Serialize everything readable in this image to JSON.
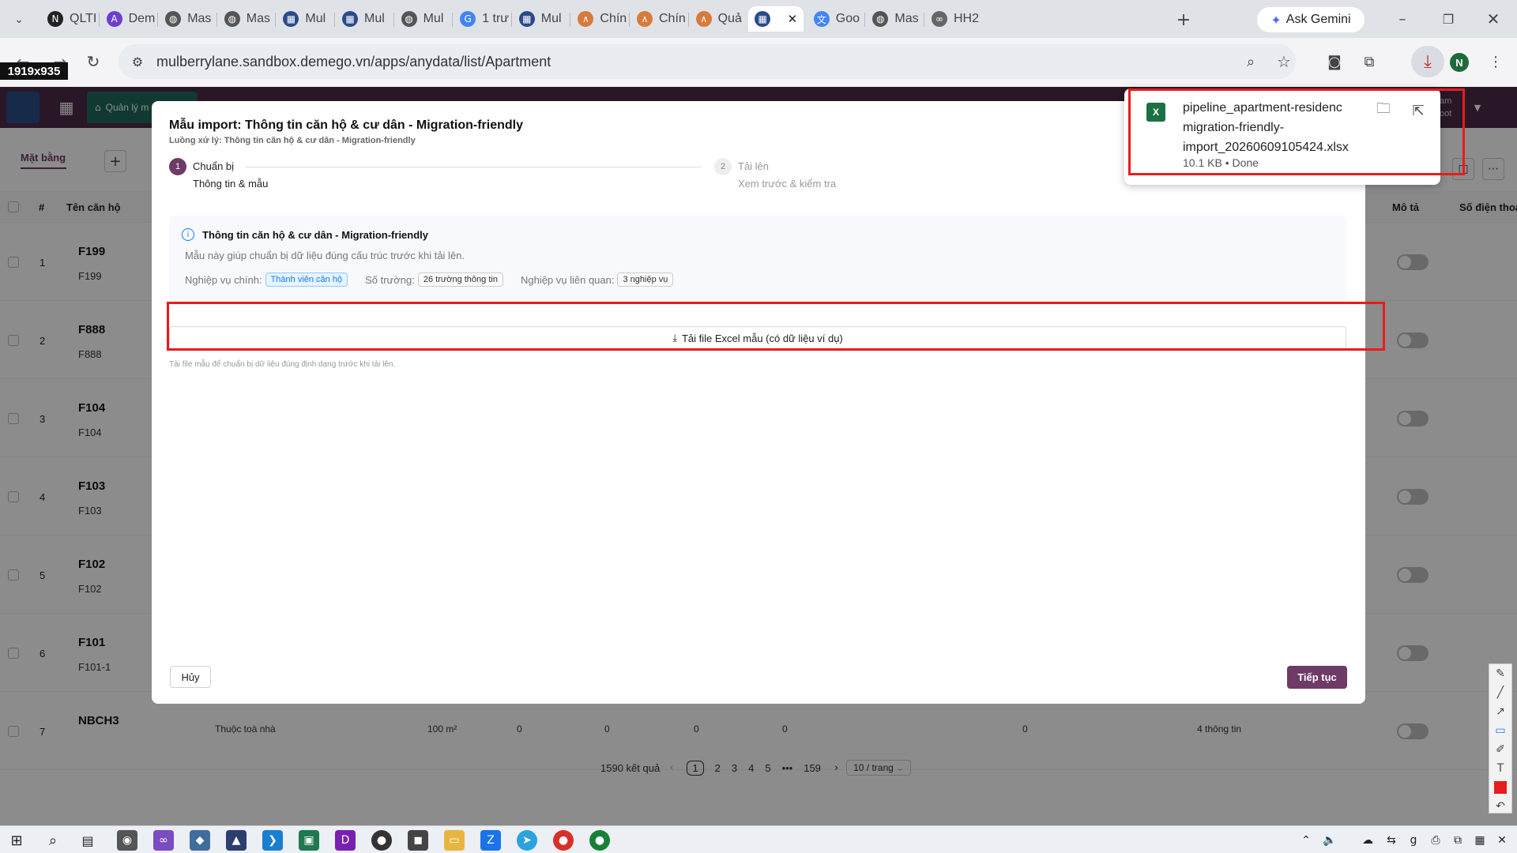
{
  "browser": {
    "tabs": [
      {
        "label": "QLTI",
        "icon": "notion-icon",
        "color": "#222"
      },
      {
        "label": "Dem",
        "icon": "app-icon",
        "color": "#6b3fd0"
      },
      {
        "label": "Mas",
        "icon": "globe-icon",
        "color": "#555"
      },
      {
        "label": "Mas",
        "icon": "globe-icon",
        "color": "#555"
      },
      {
        "label": "Mul",
        "icon": "site-icon",
        "color": "#2b4a8b"
      },
      {
        "label": "Mul",
        "icon": "site-icon",
        "color": "#2b4a8b"
      },
      {
        "label": "Mul",
        "icon": "globe-icon",
        "color": "#555"
      },
      {
        "label": "1 trư",
        "icon": "google-icon",
        "color": "#4285f4"
      },
      {
        "label": "Mul",
        "icon": "site-icon",
        "color": "#2b4a8b"
      },
      {
        "label": "Chín",
        "icon": "claude-icon",
        "color": "#d97a3a"
      },
      {
        "label": "Chín",
        "icon": "claude-icon",
        "color": "#d97a3a"
      },
      {
        "label": "Quả",
        "icon": "claude-icon",
        "color": "#d97a3a"
      },
      {
        "label": "",
        "icon": "site-icon",
        "color": "#2b4a8b"
      },
      {
        "label": "Goo",
        "icon": "translate-icon",
        "color": "#4285f4"
      },
      {
        "label": "Mas",
        "icon": "globe-icon",
        "color": "#555"
      },
      {
        "label": "HH2",
        "icon": "link-icon",
        "color": "#666"
      }
    ],
    "gemini_label": "Ask Gemini",
    "url": "mulberrylane.sandbox.demego.vn/apps/anydata/list/Apartment",
    "profile_initial": "N"
  },
  "capture_badge": "1919x935",
  "app": {
    "nav_label": "Quản lý m",
    "user_line1": "am",
    "user_line2": "oot",
    "view_tab": "Mặt bằng",
    "columns": {
      "hash": "#",
      "name": "Tên căn hộ",
      "desc": "Mô tả",
      "phone": "Số điện thoại"
    },
    "rows": [
      {
        "index": "1",
        "code": "F199",
        "sub": "F199"
      },
      {
        "index": "2",
        "code": "F888",
        "sub": "F888"
      },
      {
        "index": "3",
        "code": "F104",
        "sub": "F104"
      },
      {
        "index": "4",
        "code": "F103",
        "sub": "F103"
      },
      {
        "index": "5",
        "code": "F102",
        "sub": "F102"
      },
      {
        "index": "6",
        "code": "F101",
        "sub": "F101-1"
      },
      {
        "index": "7",
        "code": "NBCH3",
        "sub": ""
      }
    ],
    "row7_cells": {
      "type": "Thuộc toà nhà",
      "area": "100 m²",
      "v1": "0",
      "v2": "0",
      "v3": "0",
      "v4": "0",
      "v5": "0",
      "info": "4 thông tin"
    },
    "pagination": {
      "total": "1590 kết quả",
      "pages": [
        "1",
        "2",
        "3",
        "4",
        "5",
        "•••",
        "159"
      ],
      "page_size": "10 / trang"
    }
  },
  "modal": {
    "title": "Mẫu import: Thông tin căn hộ & cư dân - Migration-friendly",
    "subtitle": "Luồng xử lý: Thông tin căn hộ & cư dân - Migration-friendly",
    "steps": [
      {
        "num": "1",
        "title": "Chuẩn bị",
        "desc": "Thông tin & mẫu"
      },
      {
        "num": "2",
        "title": "Tải lên",
        "desc": "Xem trước & kiểm tra"
      }
    ],
    "info_title": "Thông tin căn hộ & cư dân - Migration-friendly",
    "info_desc": "Mẫu này giúp chuẩn bị dữ liệu đúng cấu trúc trước khi tải lên.",
    "meta": {
      "main_label": "Nghiệp vụ chính:",
      "main_value": "Thành viên căn hộ",
      "fields_label": "Số trường:",
      "fields_value": "26 trường thông tin",
      "related_label": "Nghiệp vụ liên quan:",
      "related_value": "3 nghiệp vụ"
    },
    "download_button": "Tải file Excel mẫu (có dữ liệu ví dụ)",
    "download_hint": "Tải file mẫu để chuẩn bị dữ liệu đúng định dạng trước khi tải lên.",
    "cancel_button": "Hủy",
    "next_button": "Tiếp tục"
  },
  "download_popup": {
    "filename_line1": "pipeline_apartment-residenc",
    "filename_line2": "migration-friendly-",
    "filename_line3": "import_20260609105424.xlsx",
    "status": "10.1 KB • Done"
  },
  "colors": {
    "accent": "#6e3a66",
    "highlight": "#e81c1c",
    "link": "#1677ff"
  }
}
